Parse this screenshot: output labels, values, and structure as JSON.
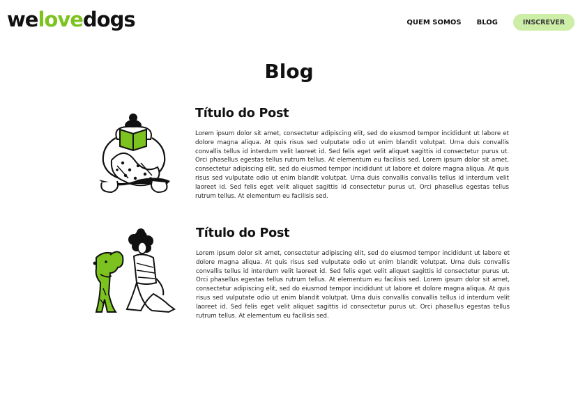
{
  "brand": {
    "logo_we": "we",
    "logo_love": "love",
    "logo_dogs": "dogs",
    "accent_color": "#7cc31f",
    "cta_bg_color": "#cdeea7"
  },
  "nav": {
    "items": [
      {
        "label": "QUEM SOMOS"
      },
      {
        "label": "BLOG"
      }
    ],
    "cta_label": "INSCREVER"
  },
  "page": {
    "title": "Blog"
  },
  "posts": [
    {
      "title": "Título do Post",
      "body": "Lorem ipsum dolor sit amet, consectetur adipiscing elit, sed do eiusmod tempor incididunt ut labore et dolore magna aliqua. At quis risus sed vulputate odio ut enim blandit volutpat. Urna duis convallis convallis tellus id interdum velit laoreet id. Sed felis eget velit aliquet sagittis id consectetur purus ut. Orci phasellus egestas tellus rutrum tellus. At elementum eu facilisis sed. Lorem ipsum dolor sit amet, consectetur adipiscing elit, sed do eiusmod tempor incididunt ut labore et dolore magna aliqua. At quis risus sed vulputate odio ut enim blandit volutpat. Urna duis convallis convallis tellus id interdum velit laoreet id. Sed felis eget velit aliquet sagittis id consectetur purus ut. Orci phasellus egestas tellus rutrum tellus. At elementum eu facilisis sed.",
      "illustration": "person-reading-book-illustration"
    },
    {
      "title": "Título do Post",
      "body": "Lorem ipsum dolor sit amet, consectetur adipiscing elit, sed do eiusmod tempor incididunt ut labore et dolore magna aliqua. At quis risus sed vulputate odio ut enim blandit volutpat. Urna duis convallis convallis tellus id interdum velit laoreet id. Sed felis eget velit aliquet sagittis id consectetur purus ut. Orci phasellus egestas tellus rutrum tellus. At elementum eu facilisis sed. Lorem ipsum dolor sit amet, consectetur adipiscing elit, sed do eiusmod tempor incididunt ut labore et dolore magna aliqua. At quis risus sed vulputate odio ut enim blandit volutpat. Urna duis convallis convallis tellus id interdum velit laoreet id. Sed felis eget velit aliquet sagittis id consectetur purus ut. Orci phasellus egestas tellus rutrum tellus. At elementum eu facilisis sed.",
      "illustration": "woman-with-dog-illustration"
    }
  ]
}
